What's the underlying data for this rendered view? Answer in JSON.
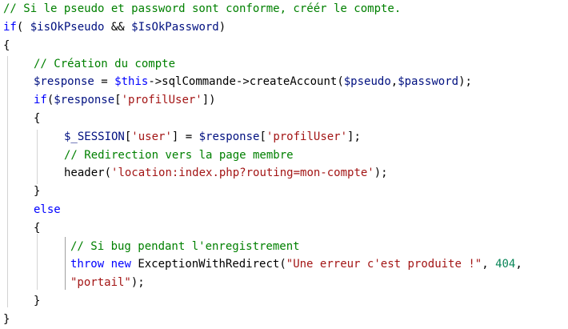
{
  "theme": {
    "background": "#ffffff",
    "comment": "#008000",
    "keyword": "#0000ff",
    "variable": "#001080",
    "string": "#a31515",
    "number": "#098658",
    "plain": "#000000",
    "guide": "#d3d3d3",
    "active_guide": "#a0a0a0"
  },
  "code": {
    "lines": [
      {
        "tokens": [
          {
            "t": "comment",
            "v": "// Si le pseudo et password sont conforme, créér le compte."
          }
        ]
      },
      {
        "tokens": [
          {
            "t": "keyword",
            "v": "if"
          },
          {
            "t": "plain",
            "v": "( "
          },
          {
            "t": "variable",
            "v": "$isOkPseudo"
          },
          {
            "t": "plain",
            "v": " && "
          },
          {
            "t": "variable",
            "v": "$IsOkPassword"
          },
          {
            "t": "plain",
            "v": ")"
          }
        ]
      },
      {
        "tokens": [
          {
            "t": "plain",
            "v": "{"
          }
        ]
      },
      {
        "tokens": [
          {
            "t": "comment",
            "v": "// Création du compte"
          }
        ]
      },
      {
        "tokens": [
          {
            "t": "variable",
            "v": "$response"
          },
          {
            "t": "plain",
            "v": " = "
          },
          {
            "t": "keyword",
            "v": "$this"
          },
          {
            "t": "plain",
            "v": "->sqlCommande->createAccount("
          },
          {
            "t": "variable",
            "v": "$pseudo"
          },
          {
            "t": "plain",
            "v": ","
          },
          {
            "t": "variable",
            "v": "$password"
          },
          {
            "t": "plain",
            "v": ");"
          }
        ]
      },
      {
        "tokens": [
          {
            "t": "keyword",
            "v": "if"
          },
          {
            "t": "plain",
            "v": "("
          },
          {
            "t": "variable",
            "v": "$response"
          },
          {
            "t": "plain",
            "v": "["
          },
          {
            "t": "string",
            "v": "'profilUser'"
          },
          {
            "t": "plain",
            "v": "])"
          }
        ]
      },
      {
        "tokens": [
          {
            "t": "plain",
            "v": "{"
          }
        ]
      },
      {
        "tokens": [
          {
            "t": "variable",
            "v": "$_SESSION"
          },
          {
            "t": "plain",
            "v": "["
          },
          {
            "t": "string",
            "v": "'user'"
          },
          {
            "t": "plain",
            "v": "] = "
          },
          {
            "t": "variable",
            "v": "$response"
          },
          {
            "t": "plain",
            "v": "["
          },
          {
            "t": "string",
            "v": "'profilUser'"
          },
          {
            "t": "plain",
            "v": "];"
          }
        ]
      },
      {
        "tokens": [
          {
            "t": "comment",
            "v": "// Redirection vers la page membre"
          }
        ]
      },
      {
        "tokens": [
          {
            "t": "plain",
            "v": "header("
          },
          {
            "t": "string",
            "v": "'location:index.php?routing=mon-compte'"
          },
          {
            "t": "plain",
            "v": ");"
          }
        ]
      },
      {
        "tokens": [
          {
            "t": "plain",
            "v": "}"
          }
        ]
      },
      {
        "tokens": [
          {
            "t": "keyword",
            "v": "else"
          }
        ]
      },
      {
        "tokens": [
          {
            "t": "plain",
            "v": "{"
          }
        ]
      },
      {
        "tokens": [
          {
            "t": "comment",
            "v": "// Si bug pendant l'enregistrement"
          }
        ]
      },
      {
        "tokens": [
          {
            "t": "keyword",
            "v": "throw"
          },
          {
            "t": "plain",
            "v": " "
          },
          {
            "t": "keyword",
            "v": "new"
          },
          {
            "t": "plain",
            "v": " ExceptionWithRedirect("
          },
          {
            "t": "string",
            "v": "\"Une erreur c'est produite !\""
          },
          {
            "t": "plain",
            "v": ", "
          },
          {
            "t": "number",
            "v": "404"
          },
          {
            "t": "plain",
            "v": ","
          }
        ]
      },
      {
        "tokens": [
          {
            "t": "string",
            "v": "\"portail\""
          },
          {
            "t": "plain",
            "v": ");"
          }
        ]
      },
      {
        "tokens": [
          {
            "t": "plain",
            "v": "}"
          }
        ]
      },
      {
        "tokens": [
          {
            "t": "plain",
            "v": "}"
          }
        ]
      }
    ]
  }
}
